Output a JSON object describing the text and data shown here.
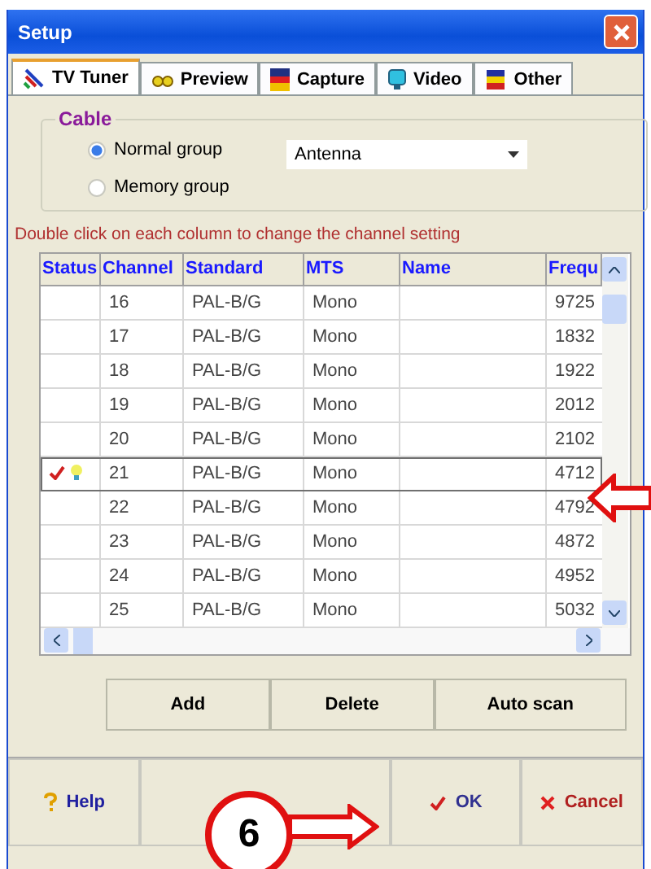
{
  "window": {
    "title": "Setup"
  },
  "tabs": [
    {
      "label": "TV Tuner",
      "selected": true,
      "kind": "tuner"
    },
    {
      "label": "Preview",
      "selected": false,
      "kind": "preview"
    },
    {
      "label": "Capture",
      "selected": false,
      "kind": "capture"
    },
    {
      "label": "Video",
      "selected": false,
      "kind": "video"
    },
    {
      "label": "Other",
      "selected": false,
      "kind": "other"
    }
  ],
  "cable": {
    "title": "Cable",
    "options": [
      {
        "label": "Normal group",
        "selected": true
      },
      {
        "label": "Memory group",
        "selected": false
      }
    ],
    "dropdown": {
      "value": "Antenna"
    }
  },
  "hint": "Double click on each column to change the channel setting",
  "table": {
    "columns": [
      "Status",
      "Channel",
      "Standard",
      "MTS",
      "Name",
      "Frequ"
    ],
    "rows": [
      {
        "status": false,
        "selected": false,
        "channel": "16",
        "standard": "PAL-B/G",
        "mts": "Mono",
        "frequency": "9725"
      },
      {
        "status": false,
        "selected": false,
        "channel": "17",
        "standard": "PAL-B/G",
        "mts": "Mono",
        "frequency": "1832"
      },
      {
        "status": false,
        "selected": false,
        "channel": "18",
        "standard": "PAL-B/G",
        "mts": "Mono",
        "frequency": "1922"
      },
      {
        "status": false,
        "selected": false,
        "channel": "19",
        "standard": "PAL-B/G",
        "mts": "Mono",
        "frequency": "2012"
      },
      {
        "status": false,
        "selected": false,
        "channel": "20",
        "standard": "PAL-B/G",
        "mts": "Mono",
        "frequency": "2102"
      },
      {
        "status": true,
        "selected": true,
        "channel": "21",
        "standard": "PAL-B/G",
        "mts": "Mono",
        "frequency": "4712"
      },
      {
        "status": false,
        "selected": false,
        "channel": "22",
        "standard": "PAL-B/G",
        "mts": "Mono",
        "frequency": "4792"
      },
      {
        "status": false,
        "selected": false,
        "channel": "23",
        "standard": "PAL-B/G",
        "mts": "Mono",
        "frequency": "4872"
      },
      {
        "status": false,
        "selected": false,
        "channel": "24",
        "standard": "PAL-B/G",
        "mts": "Mono",
        "frequency": "4952"
      },
      {
        "status": false,
        "selected": false,
        "channel": "25",
        "standard": "PAL-B/G",
        "mts": "Mono",
        "frequency": "5032"
      }
    ]
  },
  "buttons": [
    "Add",
    "Delete",
    "Auto scan"
  ],
  "footer": [
    {
      "label": "Help",
      "kind": "help"
    },
    {
      "label": "OK",
      "kind": "ok"
    },
    {
      "label": "Cancel",
      "kind": "cancel"
    }
  ],
  "annotations": [
    {
      "kind": "row-arrow"
    },
    {
      "kind": "callout",
      "label": "6"
    }
  ]
}
